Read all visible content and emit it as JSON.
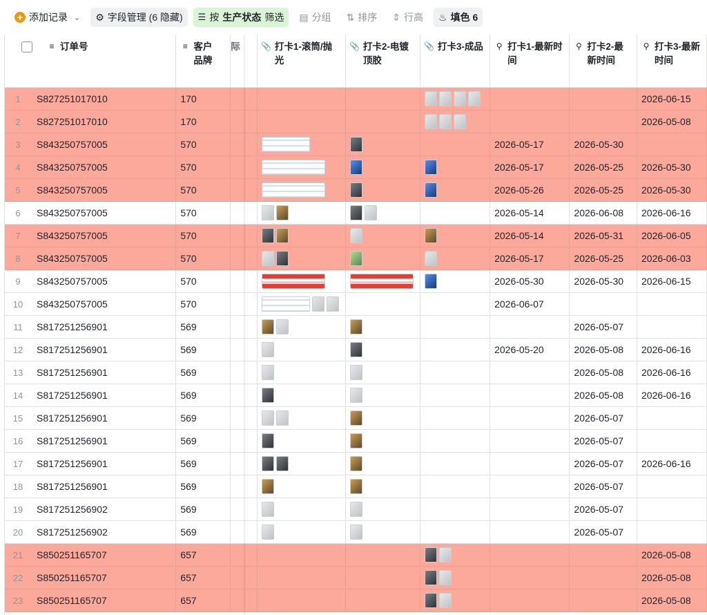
{
  "toolbar": {
    "add_record": "添加记录",
    "field_manage": "字段管理 (6 隐藏)",
    "filter_prefix": "按",
    "filter_field": "生产状态",
    "filter_suffix": "筛选",
    "group": "分组",
    "sort": "排序",
    "row_height": "行高",
    "fill": "填色 6"
  },
  "columns": {
    "order": "订单号",
    "brand": "客户品牌",
    "hidden_partial": "际",
    "check1": "打卡1-滚筒/抛光",
    "check2": "打卡2-电镀顶胶",
    "check3": "打卡3-成品",
    "time1": "打卡1-最新时间",
    "time2": "打卡2-最新时间",
    "time3": "打卡3-最新时间"
  },
  "rows": [
    {
      "n": "1",
      "order": "S827251017010",
      "brand": "170",
      "hl": true,
      "c1": [],
      "c2": [],
      "c3": [
        "light sq",
        "light sq",
        "light sq",
        "light sq"
      ],
      "t1": "",
      "t2": "",
      "t3": "2026-06-15"
    },
    {
      "n": "2",
      "order": "S827251017010",
      "brand": "170",
      "hl": true,
      "c1": [],
      "c2": [],
      "c3": [
        "light sq",
        "light sq",
        "light sq"
      ],
      "t1": "",
      "t2": "",
      "t3": "2026-05-08"
    },
    {
      "n": "3",
      "order": "S843250757005",
      "brand": "570",
      "hl": true,
      "c1": [
        "doc w"
      ],
      "c2": [
        "dark sq"
      ],
      "c3": [],
      "t1": "2026-05-17",
      "t2": "2026-05-30",
      "t3": ""
    },
    {
      "n": "4",
      "order": "S843250757005",
      "brand": "570",
      "hl": true,
      "c1": [
        "doc w2"
      ],
      "c2": [
        "blue sq"
      ],
      "c3": [
        "blue sq"
      ],
      "t1": "2026-05-17",
      "t2": "2026-05-25",
      "t3": "2026-05-30"
    },
    {
      "n": "5",
      "order": "S843250757005",
      "brand": "570",
      "hl": true,
      "c1": [
        "doc w2"
      ],
      "c2": [
        "dark sq"
      ],
      "c3": [
        "blue sq"
      ],
      "t1": "2026-05-26",
      "t2": "2026-05-25",
      "t3": "2026-05-30"
    },
    {
      "n": "6",
      "order": "S843250757005",
      "brand": "570",
      "hl": false,
      "c1": [
        "light sq",
        "gold sq"
      ],
      "c2": [
        "dark sq",
        "light sq"
      ],
      "c3": [],
      "t1": "2026-05-14",
      "t2": "2026-06-08",
      "t3": "2026-06-16"
    },
    {
      "n": "7",
      "order": "S843250757005",
      "brand": "570",
      "hl": true,
      "c1": [
        "dark sq",
        "gold sq"
      ],
      "c2": [
        "light sq"
      ],
      "c3": [
        "gold sq"
      ],
      "t1": "2026-05-14",
      "t2": "2026-05-31",
      "t3": "2026-06-05"
    },
    {
      "n": "8",
      "order": "S843250757005",
      "brand": "570",
      "hl": true,
      "c1": [
        "light sq",
        "dark sq"
      ],
      "c2": [
        "green sq"
      ],
      "c3": [
        "light sq"
      ],
      "t1": "2026-05-17",
      "t2": "2026-05-25",
      "t3": "2026-06-03"
    },
    {
      "n": "9",
      "order": "S843250757005",
      "brand": "570",
      "hl": false,
      "c1": [
        "red w2"
      ],
      "c2": [
        "red w2"
      ],
      "c3": [
        "blue sq"
      ],
      "t1": "2026-05-30",
      "t2": "2026-05-30",
      "t3": "2026-06-15"
    },
    {
      "n": "10",
      "order": "S843250757005",
      "brand": "570",
      "hl": false,
      "c1": [
        "doc w",
        "light sq",
        "light sq"
      ],
      "c2": [],
      "c3": [],
      "t1": "2026-06-07",
      "t2": "",
      "t3": ""
    },
    {
      "n": "11",
      "order": "S817251256901",
      "brand": "569",
      "hl": false,
      "c1": [
        "gold sq",
        "light sq"
      ],
      "c2": [
        "gold sq"
      ],
      "c3": [],
      "t1": "",
      "t2": "2026-05-07",
      "t3": ""
    },
    {
      "n": "12",
      "order": "S817251256901",
      "brand": "569",
      "hl": false,
      "c1": [
        "light sq"
      ],
      "c2": [
        "dark sq"
      ],
      "c3": [],
      "t1": "2026-05-20",
      "t2": "2026-05-08",
      "t3": "2026-06-16"
    },
    {
      "n": "13",
      "order": "S817251256901",
      "brand": "569",
      "hl": false,
      "c1": [
        "light sq"
      ],
      "c2": [
        "light sq"
      ],
      "c3": [],
      "t1": "",
      "t2": "2026-05-08",
      "t3": "2026-06-16"
    },
    {
      "n": "14",
      "order": "S817251256901",
      "brand": "569",
      "hl": false,
      "c1": [
        "dark sq"
      ],
      "c2": [
        "light sq"
      ],
      "c3": [],
      "t1": "",
      "t2": "2026-05-08",
      "t3": "2026-06-16"
    },
    {
      "n": "15",
      "order": "S817251256901",
      "brand": "569",
      "hl": false,
      "c1": [
        "light sq",
        "light sq"
      ],
      "c2": [
        "gold sq"
      ],
      "c3": [],
      "t1": "",
      "t2": "2026-05-07",
      "t3": ""
    },
    {
      "n": "16",
      "order": "S817251256901",
      "brand": "569",
      "hl": false,
      "c1": [
        "dark sq"
      ],
      "c2": [
        "gold sq"
      ],
      "c3": [],
      "t1": "",
      "t2": "2026-05-07",
      "t3": ""
    },
    {
      "n": "17",
      "order": "S817251256901",
      "brand": "569",
      "hl": false,
      "c1": [
        "dark sq",
        "dark sq"
      ],
      "c2": [
        "gold sq"
      ],
      "c3": [],
      "t1": "",
      "t2": "2026-05-07",
      "t3": "2026-06-16"
    },
    {
      "n": "18",
      "order": "S817251256901",
      "brand": "569",
      "hl": false,
      "c1": [
        "gold sq"
      ],
      "c2": [
        "gold sq"
      ],
      "c3": [],
      "t1": "",
      "t2": "2026-05-07",
      "t3": ""
    },
    {
      "n": "19",
      "order": "S817251256902",
      "brand": "569",
      "hl": false,
      "c1": [
        "light sq"
      ],
      "c2": [
        "light sq"
      ],
      "c3": [],
      "t1": "",
      "t2": "2026-05-07",
      "t3": ""
    },
    {
      "n": "20",
      "order": "S817251256902",
      "brand": "569",
      "hl": false,
      "c1": [
        "light sq"
      ],
      "c2": [
        "light sq"
      ],
      "c3": [],
      "t1": "",
      "t2": "2026-05-07",
      "t3": ""
    },
    {
      "n": "21",
      "order": "S850251165707",
      "brand": "657",
      "hl": true,
      "c1": [],
      "c2": [],
      "c3": [
        "dark sq",
        "light sq"
      ],
      "t1": "",
      "t2": "",
      "t3": "2026-05-08"
    },
    {
      "n": "22",
      "order": "S850251165707",
      "brand": "657",
      "hl": true,
      "c1": [],
      "c2": [],
      "c3": [
        "dark sq",
        "light sq"
      ],
      "t1": "",
      "t2": "",
      "t3": "2026-05-08"
    },
    {
      "n": "23",
      "order": "S850251165707",
      "brand": "657",
      "hl": true,
      "c1": [],
      "c2": [],
      "c3": [
        "dark sq",
        "light sq"
      ],
      "t1": "",
      "t2": "",
      "t3": "2026-05-08"
    }
  ],
  "colors": {
    "highlight_row": "#fca99b",
    "filter_bg": "#d9f5d6",
    "add_icon": "#e59b16"
  }
}
